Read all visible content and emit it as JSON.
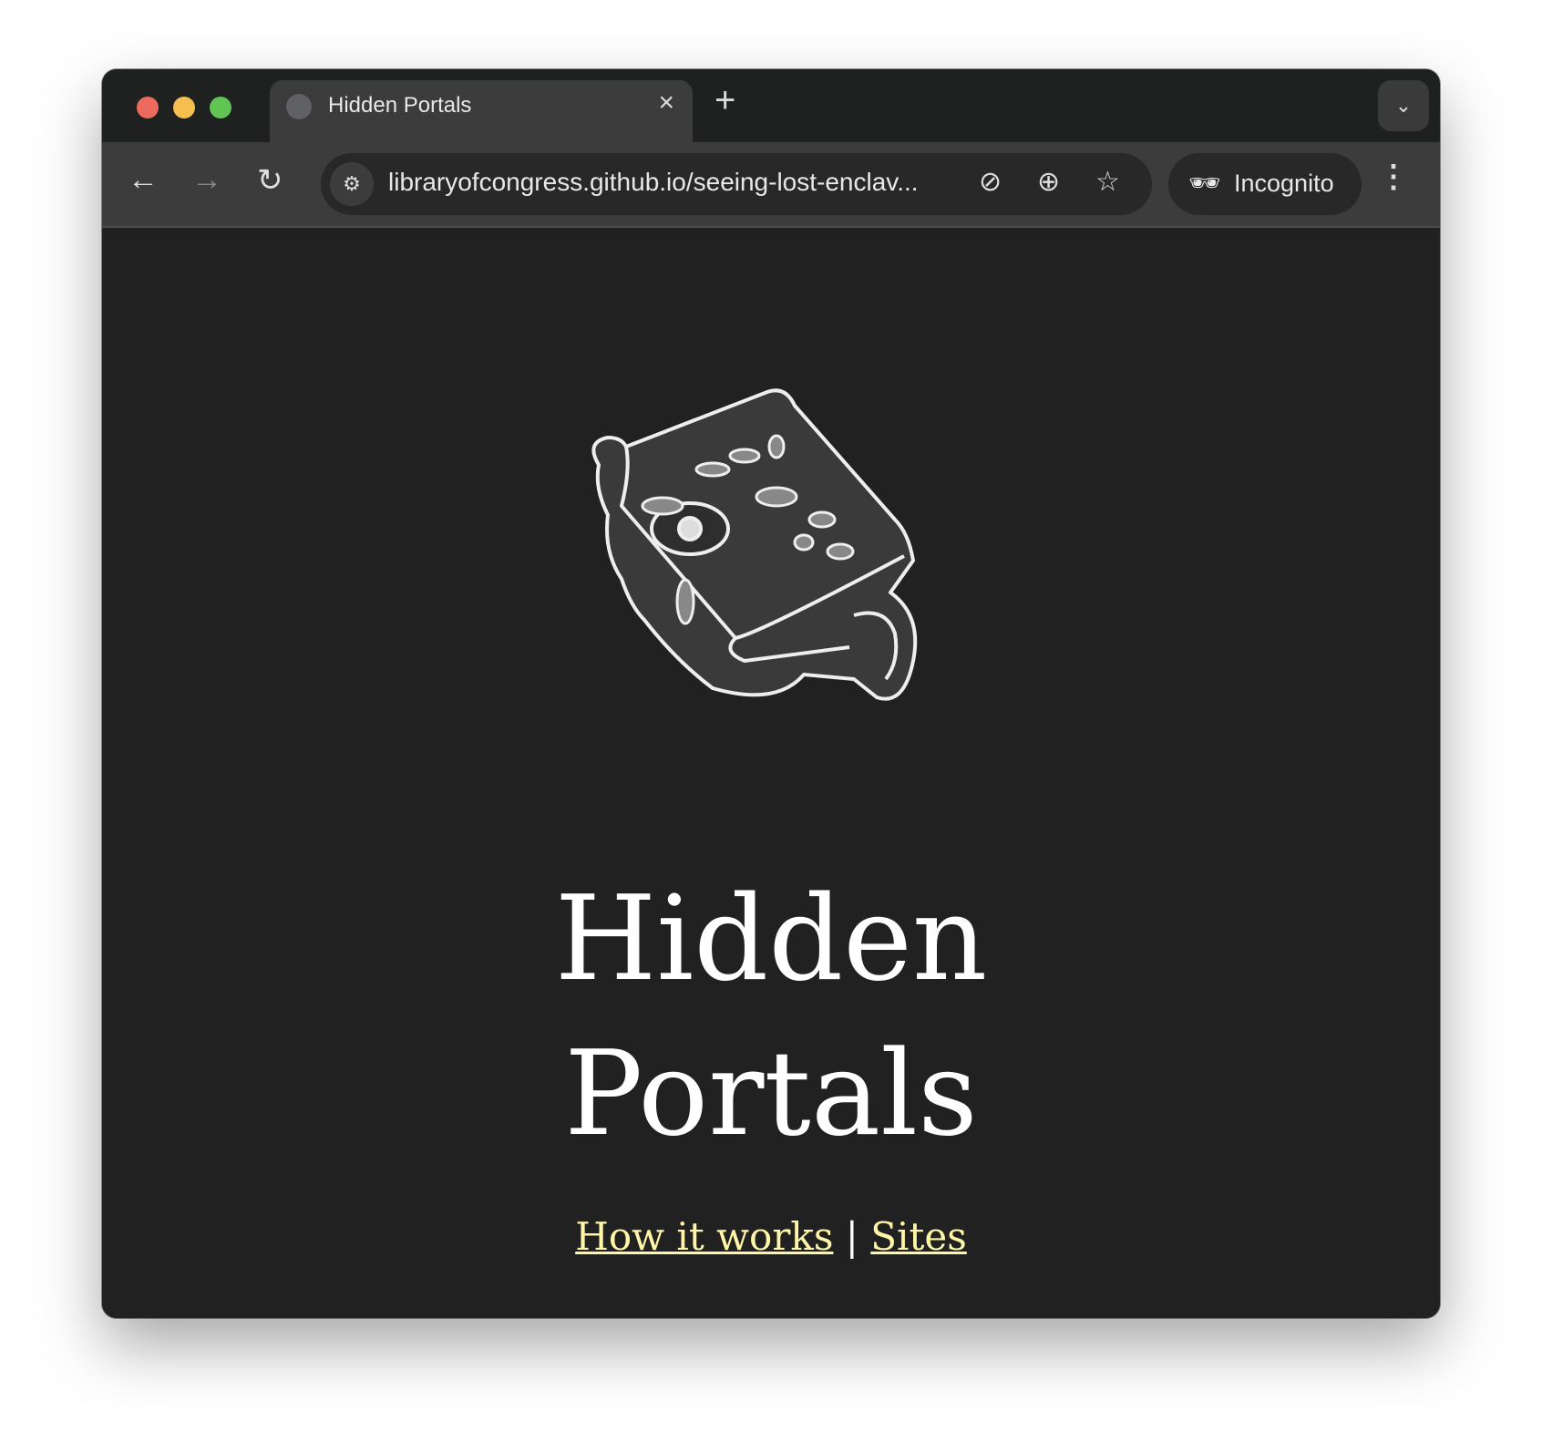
{
  "browser": {
    "tab_title": "Hidden Portals",
    "tab_close": "×",
    "new_tab": "+",
    "tab_menu": "⌄",
    "url": "libraryofcongress.github.io/seeing-lost-enclav...",
    "incognito_label": "Incognito",
    "traffic_light_colors": {
      "close": "#ed6a5e",
      "minimize": "#f5bf4f",
      "maximize": "#61c554"
    }
  },
  "page": {
    "title_line1": "Hidden",
    "title_line2": "Portals",
    "links": [
      {
        "label": "How it works"
      },
      {
        "label": "Sites"
      }
    ],
    "separator": "|",
    "link_color": "#fff6a8"
  }
}
